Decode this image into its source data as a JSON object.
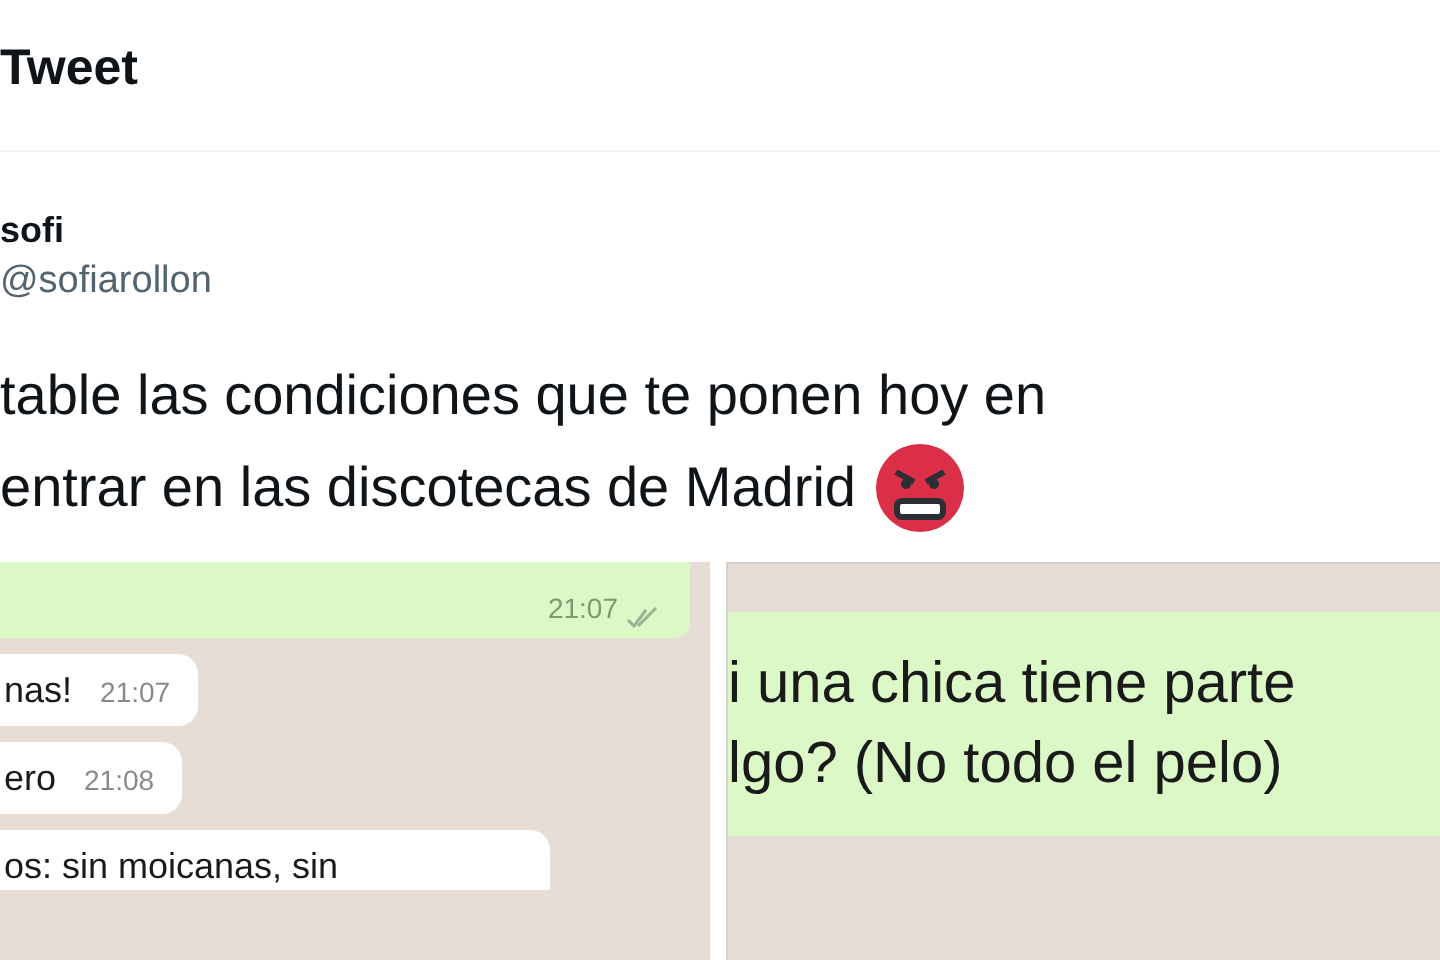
{
  "header": {
    "title": "Tweet"
  },
  "author": {
    "name": "sofi",
    "handle": "@sofiarollon"
  },
  "tweet": {
    "lines": [
      "table las condiciones que te ponen hoy en",
      "entrar en las discotecas de Madrid"
    ]
  },
  "images": [
    {
      "messages": [
        {
          "kind": "sent",
          "time": "21:07",
          "read": true
        },
        {
          "kind": "received",
          "text": "nas!",
          "time": "21:07"
        },
        {
          "kind": "received",
          "text": "ero",
          "time": "21:08"
        },
        {
          "kind": "received",
          "text": "os: sin moicanas, sin"
        }
      ]
    },
    {
      "messages": [
        {
          "kind": "sent",
          "lines": [
            "i una chica tiene parte",
            "lgo? (No todo el pelo)"
          ]
        }
      ]
    }
  ]
}
